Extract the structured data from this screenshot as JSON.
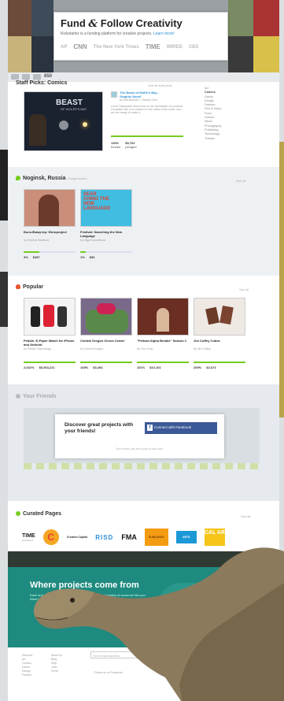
{
  "hero": {
    "title_a": "Fund ",
    "title_amp": "&",
    "title_b": " Follow Creativity",
    "subtitle": "Kickstarter is a funding platform for creative projects.",
    "learn_more": "Learn more!",
    "press": [
      "AP",
      "CNN",
      "The New York Times",
      "TIME",
      "WIRED",
      "CBS"
    ]
  },
  "top_strip": {
    "number": "850"
  },
  "staff_picks": {
    "heading": "Staff Picks: Comics",
    "see_all": "See all staff picks",
    "project_title": "The Beast of Wolfe's Bay - Graphic Novel",
    "project_author": "by Erik Bennett + Stacey Kohl",
    "project_blurb": "A true Sasquatch story built on the foundation of a classic Canadian tale of a creature in the wilds of the north. And we are ready to make it.",
    "image_text_1": "BEAST",
    "image_text_2": "OF WOLFE'S BAY",
    "funded_pct": "115%",
    "funded_label": "funded",
    "pledged": "$5,702",
    "pledged_label": "pledged",
    "progress": 1.0,
    "categories": [
      "Art",
      "Comics",
      "Dance",
      "Design",
      "Fashion",
      "Film & Video",
      "Food",
      "Games",
      "Music",
      "Photography",
      "Publishing",
      "Technology",
      "Theater"
    ]
  },
  "local": {
    "heading": "Noginsk, Russia",
    "change": "Change location",
    "see_all": "See all",
    "items": [
      {
        "title": "Быть/Бижутер: Фотоproject",
        "meta": "by Kristina Vasilieva",
        "progress": 0.3,
        "s1": "3%",
        "s2": "$497"
      },
      {
        "title": "Festival: Searching the New Language",
        "meta": "by Olga Kuznetsova",
        "progress": 0.1,
        "s1": "1%",
        "s2": "$30"
      }
    ],
    "poster_text": "SEAR CHING THE NEW LANGUAGE"
  },
  "popular": {
    "heading": "Popular",
    "see_all": "See all",
    "items": [
      {
        "title": "Pebble: E-Paper Watch for iPhone and Android",
        "meta": "by Pebble Technology",
        "progress": 1.0,
        "s1": "2,042%",
        "s2": "$6,063,221"
      },
      {
        "title": "Central Oregon Circus Center",
        "meta": "by Central Oregon",
        "progress": 1.0,
        "s1": "108%",
        "s2": "$3,494"
      },
      {
        "title": "\"Pelican Alpha Breaks\" Season 2",
        "meta": "by The Crew",
        "progress": 1.0,
        "s1": "101%",
        "s2": "$10,101"
      },
      {
        "title": "Jim Coffey Cubes",
        "meta": "by Jim Coffey",
        "progress": 1.0,
        "s1": "269%",
        "s2": "$2,674"
      }
    ]
  },
  "friends": {
    "heading": "Your Friends",
    "card_title": "Discover great projects with your friends!",
    "fb_button": "Connect with Facebook",
    "fine": "Don't worry, we won't post to your wall."
  },
  "curated": {
    "heading": "Curated Pages",
    "see_all": "See all",
    "logos": [
      "TIME",
      "C",
      "Creative Capital",
      "RISD",
      "FMA",
      "SUNDANCE",
      "ARTS",
      "CAL ARTS"
    ],
    "time_sub": "Exhibitions"
  },
  "where": {
    "title": "Where projects come from",
    "subtitle": "Each and every Kickstarter project is the independent creation of someone like you. Want to see more? Projects are from all over. Where does it all come? Learn more"
  },
  "footer": {
    "col1": [
      "Discover",
      "Art",
      "Comics",
      "Dance",
      "Design",
      "Fashion"
    ],
    "col2": [
      "About us",
      "Blog",
      "Help",
      "Jobs",
      "Press"
    ],
    "email_placeholder": "Your email address",
    "signup": "Sign up",
    "follow": "Follow us on Facebook"
  },
  "colors": {
    "green": "#76cc1e",
    "teal": "#1f8a80",
    "facebook": "#3b5998"
  }
}
